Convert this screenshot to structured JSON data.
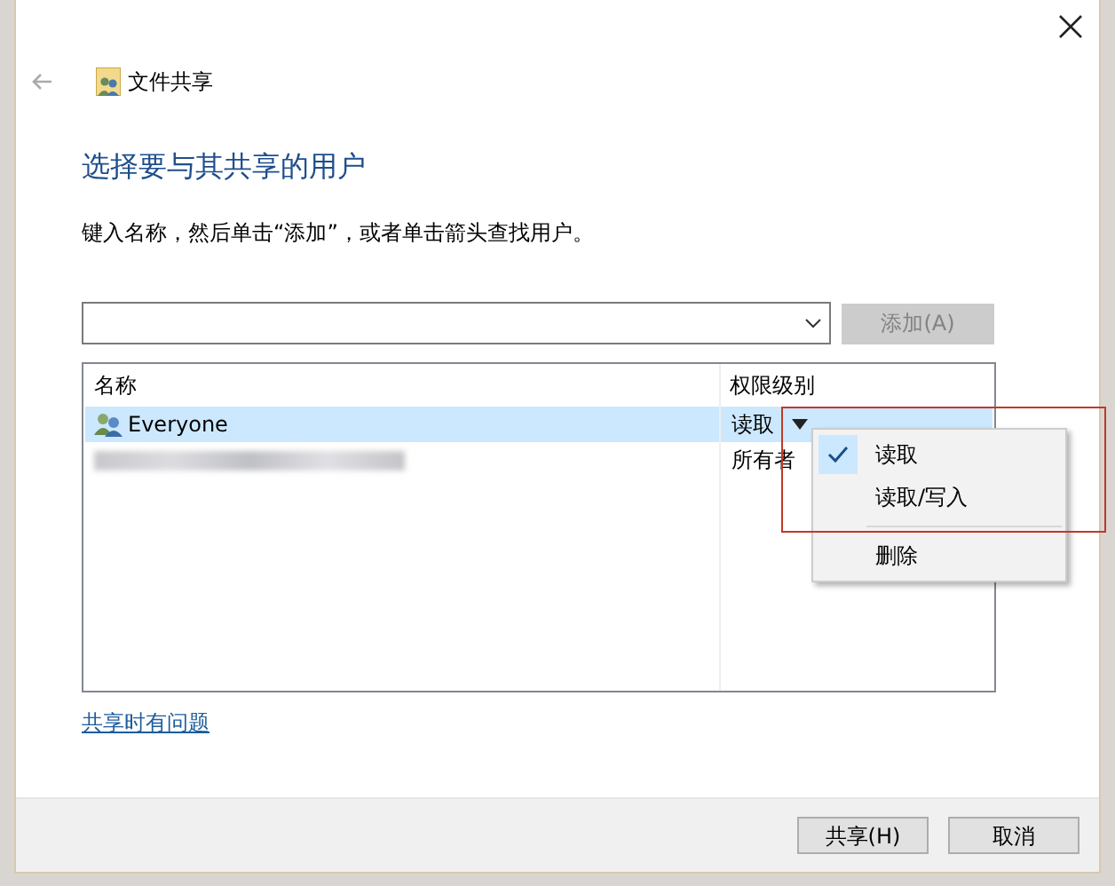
{
  "window": {
    "title": "文件共享"
  },
  "heading": "选择要与其共享的用户",
  "instruction": "键入名称，然后单击“添加”，或者单击箭头查找用户。",
  "add_button": {
    "label": "添加(A)",
    "disabled": true
  },
  "table": {
    "columns": [
      "名称",
      "权限级别"
    ],
    "rows": [
      {
        "kind": "user",
        "name": "Everyone",
        "permission": "读取",
        "selected": true
      },
      {
        "kind": "blurred",
        "permission": "所有者",
        "selected": false
      }
    ]
  },
  "menu": [
    {
      "kind": "item",
      "label": "读取",
      "checked": true
    },
    {
      "kind": "item",
      "label": "读取/写入",
      "checked": false
    },
    {
      "kind": "separator"
    },
    {
      "kind": "item",
      "label": "删除",
      "checked": false
    }
  ],
  "help_link": "共享时有问题",
  "buttons": [
    {
      "label": "共享(H)"
    },
    {
      "label": "取消"
    }
  ]
}
